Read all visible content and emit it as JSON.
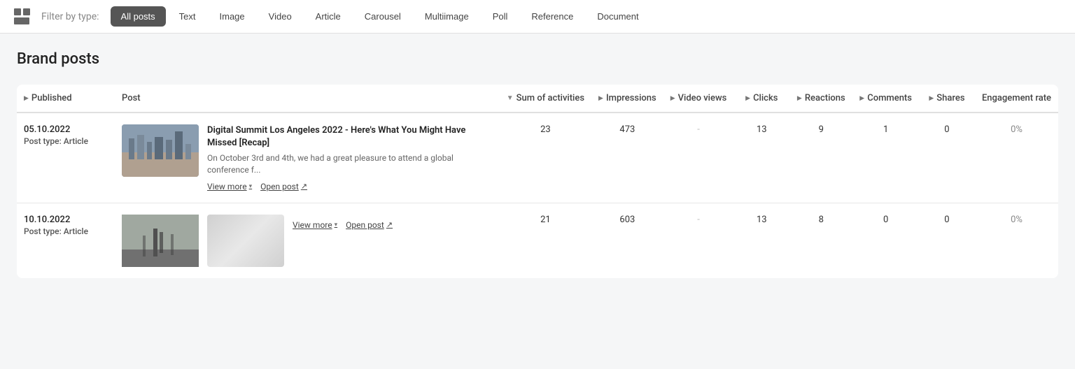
{
  "topbar": {
    "filter_label": "Filter by type:",
    "filters": [
      {
        "id": "all-posts",
        "label": "All posts",
        "active": true
      },
      {
        "id": "text",
        "label": "Text",
        "active": false
      },
      {
        "id": "image",
        "label": "Image",
        "active": false
      },
      {
        "id": "video",
        "label": "Video",
        "active": false
      },
      {
        "id": "article",
        "label": "Article",
        "active": false
      },
      {
        "id": "carousel",
        "label": "Carousel",
        "active": false
      },
      {
        "id": "multiimage",
        "label": "Multiimage",
        "active": false
      },
      {
        "id": "poll",
        "label": "Poll",
        "active": false
      },
      {
        "id": "reference",
        "label": "Reference",
        "active": false
      },
      {
        "id": "document",
        "label": "Document",
        "active": false
      }
    ]
  },
  "section": {
    "title": "Brand posts"
  },
  "table": {
    "columns": [
      {
        "id": "published",
        "label": "Published",
        "sortable": true
      },
      {
        "id": "post",
        "label": "Post",
        "sortable": false
      },
      {
        "id": "sum_activities",
        "label": "Sum of activities",
        "sortable": true
      },
      {
        "id": "impressions",
        "label": "Impressions",
        "sortable": true
      },
      {
        "id": "video_views",
        "label": "Video views",
        "sortable": true
      },
      {
        "id": "clicks",
        "label": "Clicks",
        "sortable": true
      },
      {
        "id": "reactions",
        "label": "Reactions",
        "sortable": true
      },
      {
        "id": "comments",
        "label": "Comments",
        "sortable": true
      },
      {
        "id": "shares",
        "label": "Shares",
        "sortable": true
      },
      {
        "id": "engagement_rate",
        "label": "Engagement rate",
        "sortable": false
      }
    ],
    "rows": [
      {
        "date": "05.10.2022",
        "post_type_label": "Post type:",
        "post_type": "Article",
        "image_type": "city",
        "title": "Digital Summit Los Angeles 2022 - Here's What You Might Have Missed [Recap]",
        "excerpt": "On October 3rd and 4th, we had a great pleasure to attend a global conference f...",
        "view_more": "View more",
        "open_post": "Open post",
        "sum_activities": "23",
        "impressions": "473",
        "video_views": "-",
        "clicks": "13",
        "reactions": "9",
        "comments": "1",
        "shares": "0",
        "engagement_rate": "0%"
      },
      {
        "date": "10.10.2022",
        "post_type_label": "Post type:",
        "post_type": "Article",
        "image_type": "walk",
        "title": "",
        "excerpt": "",
        "view_more": "View more",
        "open_post": "Open post",
        "sum_activities": "21",
        "impressions": "603",
        "video_views": "-",
        "clicks": "13",
        "reactions": "8",
        "comments": "0",
        "shares": "0",
        "engagement_rate": "0%"
      }
    ]
  }
}
